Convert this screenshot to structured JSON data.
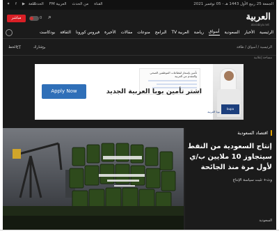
{
  "topbar": {
    "date": "الجمعة 25 ربيع الأول 1443 هـ - 05 نوفمبر 2021",
    "links": [
      "القناة",
      "من الحدث",
      "العربية FM",
      "الحدث"
    ],
    "social_icons": [
      "twitter-icon",
      "facebook-icon",
      "youtube-icon",
      "instagram-icon"
    ],
    "region_label": "اللغة"
  },
  "header": {
    "logo": "العربية",
    "logo_sub": "alarabiya.net",
    "live_label": "مباشر",
    "toggle_label": "0"
  },
  "nav": {
    "items": [
      "الرئيسية",
      "الأخبار",
      "السعودية",
      "أسواق",
      "رياضة",
      "العربية TV",
      "البرامج",
      "منوعات",
      "مقالات",
      "الأخيرة",
      "فيروس كورونا",
      "الثقافة",
      "بودكاست"
    ],
    "active_index": 3
  },
  "toolbar": {
    "breadcrumb": "الرئيسية / أسواق / طاقة",
    "share_label": "شارك",
    "font_label": "الخط"
  },
  "ad": {
    "label": "مساحة إعلانية",
    "headline": "اشتر تأمين بوبا العربية الجديد",
    "button": "Apply Now",
    "card_text": "تأمين بإسعار لقطاعات الموظفين الصحي والمقدم من العربية",
    "brand": "بوبا العربية"
  },
  "hero": {
    "tag": "اقتصاد السعودية",
    "title": "إنتاج السعودية من النفط سيتجاوز 10 ملايين ب/ي لأول مرة منذ الجائحة",
    "related": "وث+ تثبت سياسة الإنتاج",
    "bottom_tag": "السعودية"
  }
}
